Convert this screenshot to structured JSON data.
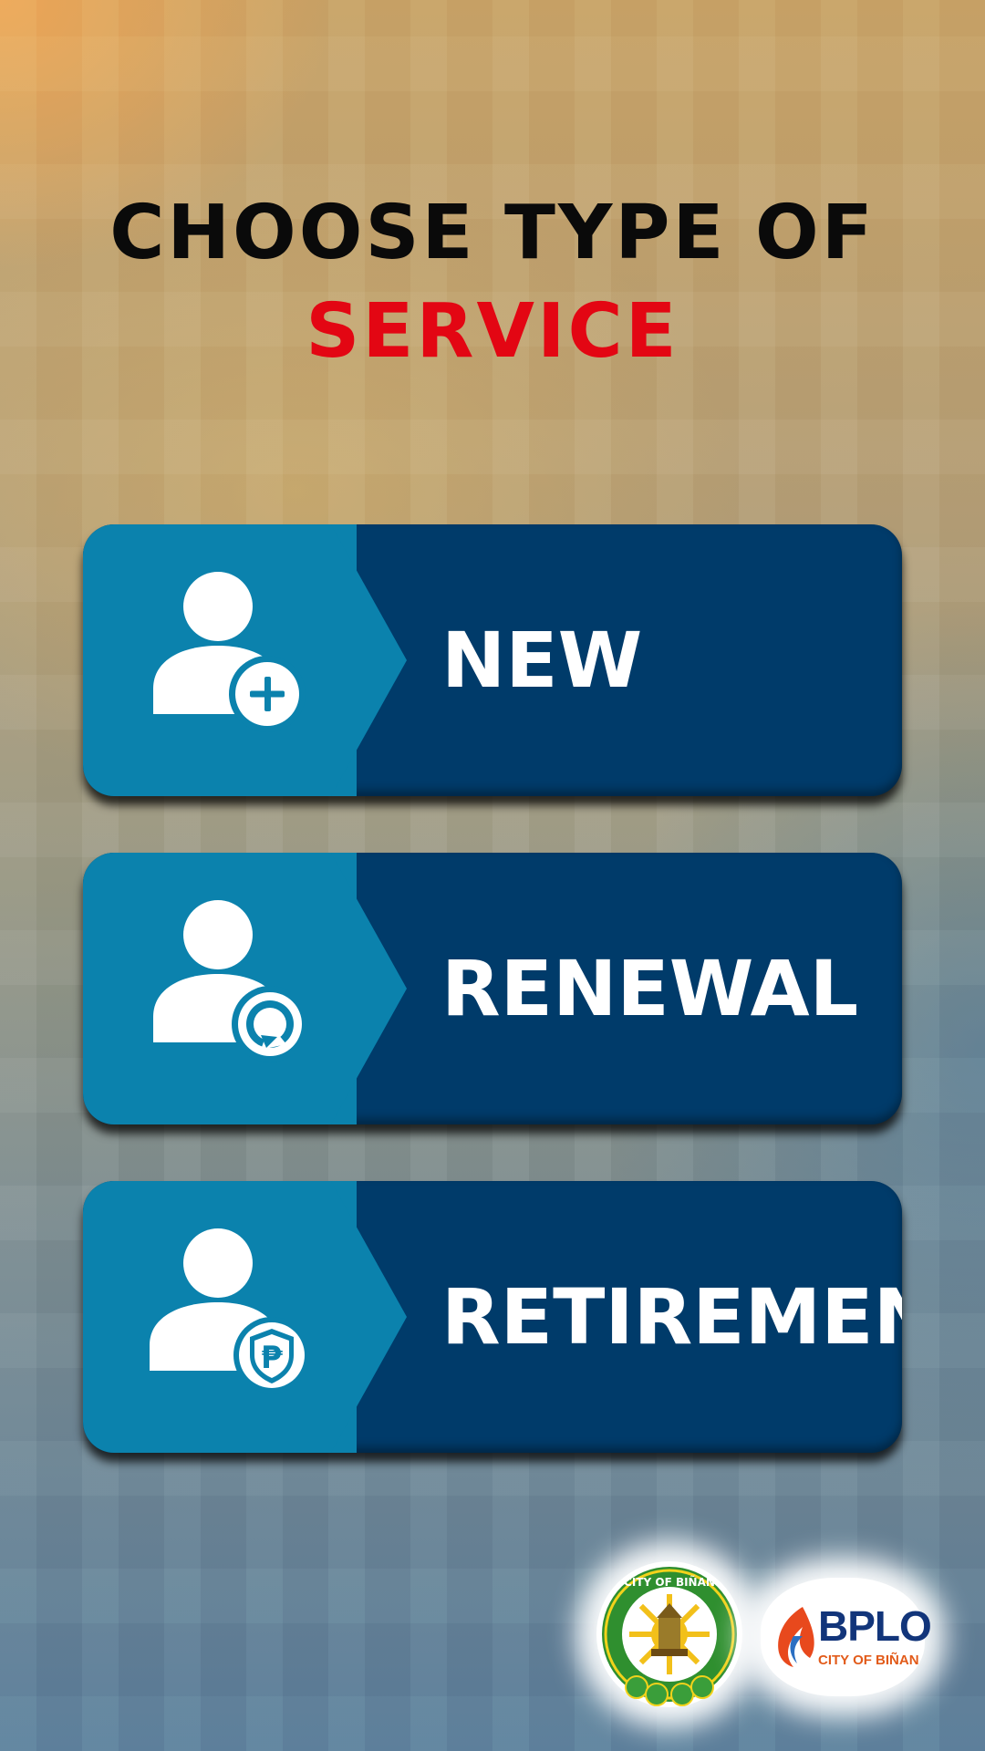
{
  "header": {
    "title_line1": "CHOOSE TYPE OF",
    "title_line2": "SERVICE"
  },
  "services": [
    {
      "label": "NEW",
      "icon": "user-add-icon"
    },
    {
      "label": "RENEWAL",
      "icon": "user-renew-icon"
    },
    {
      "label": "RETIREMENT",
      "icon": "user-shield-peso-icon"
    }
  ],
  "footer": {
    "seal_text": "CITY OF BIÑAN",
    "bplo_title": "BPLO",
    "bplo_subtitle": "CITY OF BIÑAN"
  },
  "colors": {
    "title_black": "#0a0a0a",
    "title_red": "#e30613",
    "button_dark": "#003b6a",
    "button_light": "#0b82ad"
  }
}
